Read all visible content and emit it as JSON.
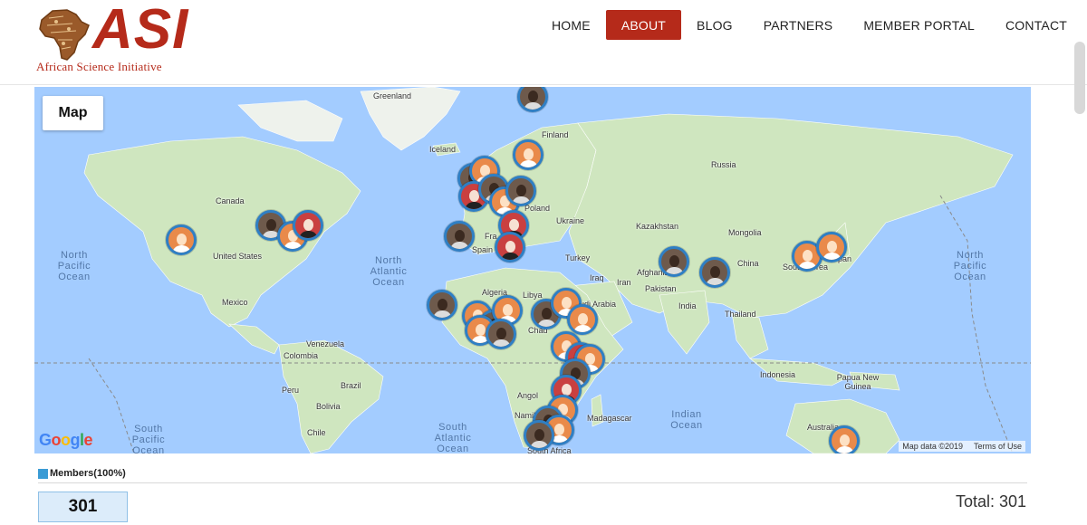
{
  "brand": {
    "logo_text": "ASI",
    "tagline": "African Science Initiative",
    "accent_color": "#b52a1a"
  },
  "nav": {
    "items": [
      {
        "label": "HOME",
        "active": false
      },
      {
        "label": "ABOUT",
        "active": true
      },
      {
        "label": "BLOG",
        "active": false
      },
      {
        "label": "PARTNERS",
        "active": false
      },
      {
        "label": "MEMBER PORTAL",
        "active": false
      },
      {
        "label": "CONTACT",
        "active": false
      }
    ]
  },
  "map": {
    "type_button": "Map",
    "labels": {
      "greenland": "Greenland",
      "iceland": "Iceland",
      "finland": "Finland",
      "russia": "Russia",
      "canada": "Canada",
      "united_states": "United States",
      "mexico": "Mexico",
      "venezuela": "Venezuela",
      "colombia": "Colombia",
      "peru": "Peru",
      "brazil": "Brazil",
      "bolivia": "Bolivia",
      "chile": "Chile",
      "poland": "Poland",
      "ukraine": "Ukraine",
      "spain": "Spain",
      "france": "Fra",
      "turkey": "Turkey",
      "iraq": "Iraq",
      "iran": "Iran",
      "saudi": "udi Arabia",
      "algeria": "Algeria",
      "libya": "Libya",
      "chad": "Chad",
      "angola": "Angol",
      "namibia": "Namib",
      "south_africa": "South Africa",
      "madagascar": "Madagascar",
      "kazakhstan": "Kazakhstan",
      "mongolia": "Mongolia",
      "china": "China",
      "afghanistan": "Afghanis",
      "pakistan": "Pakistan",
      "india": "India",
      "thailand": "Thailand",
      "indonesia": "Indonesia",
      "papua": "Papua New Guinea",
      "australia": "Australia",
      "skorea": "South Korea",
      "japan": "pan",
      "ocean_npac_l": "North Pacific Ocean",
      "ocean_npac_r": "North Pacific Ocean",
      "ocean_natl": "North Atlantic Ocean",
      "ocean_spac": "South Pacific Ocean",
      "ocean_satl": "South Atlantic Ocean",
      "ocean_ind": "Indian Ocean"
    },
    "map_data": "Map data ©2019",
    "terms": "Terms of Use"
  },
  "stats": {
    "legend_label": "Members(100%)",
    "legend_color": "#3a9bd5",
    "count": "301",
    "total": "Total: 301"
  }
}
